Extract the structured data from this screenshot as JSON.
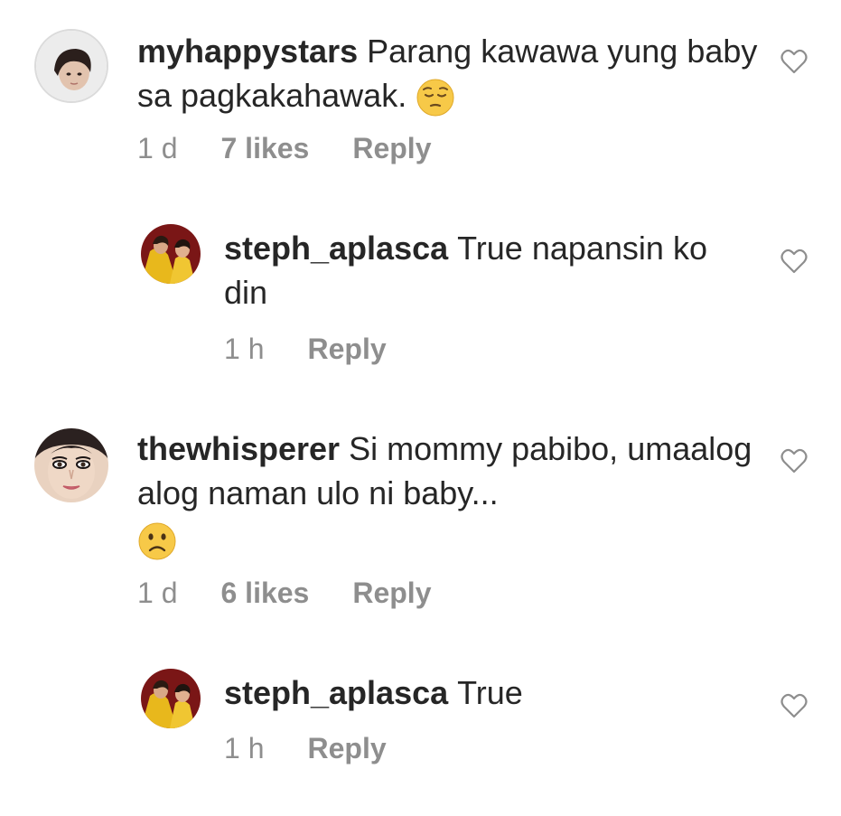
{
  "comments": [
    {
      "username": "myhappystars",
      "text": "Parang kawawa yung baby sa pagkakahawak.",
      "emoji": "pensive-face-emoji",
      "time": "1 d",
      "likes": "7 likes",
      "reply_label": "Reply"
    },
    {
      "username": "steph_aplasca",
      "text": "True napansin ko din",
      "time": "1 h",
      "reply_label": "Reply"
    },
    {
      "username": "thewhisperer",
      "text": "Si mommy pabibo, umaalog alog naman ulo ni baby...",
      "emoji": "slightly-frowning-face-emoji",
      "time": "1 d",
      "likes": "6 likes",
      "reply_label": "Reply"
    },
    {
      "username": "steph_aplasca",
      "text": "True",
      "time": "1 h",
      "reply_label": "Reply"
    }
  ],
  "colors": {
    "text": "#262626",
    "meta": "#8e8e8e",
    "emoji": "#f7c948"
  },
  "icons": {
    "like": "heart-outline-icon"
  }
}
